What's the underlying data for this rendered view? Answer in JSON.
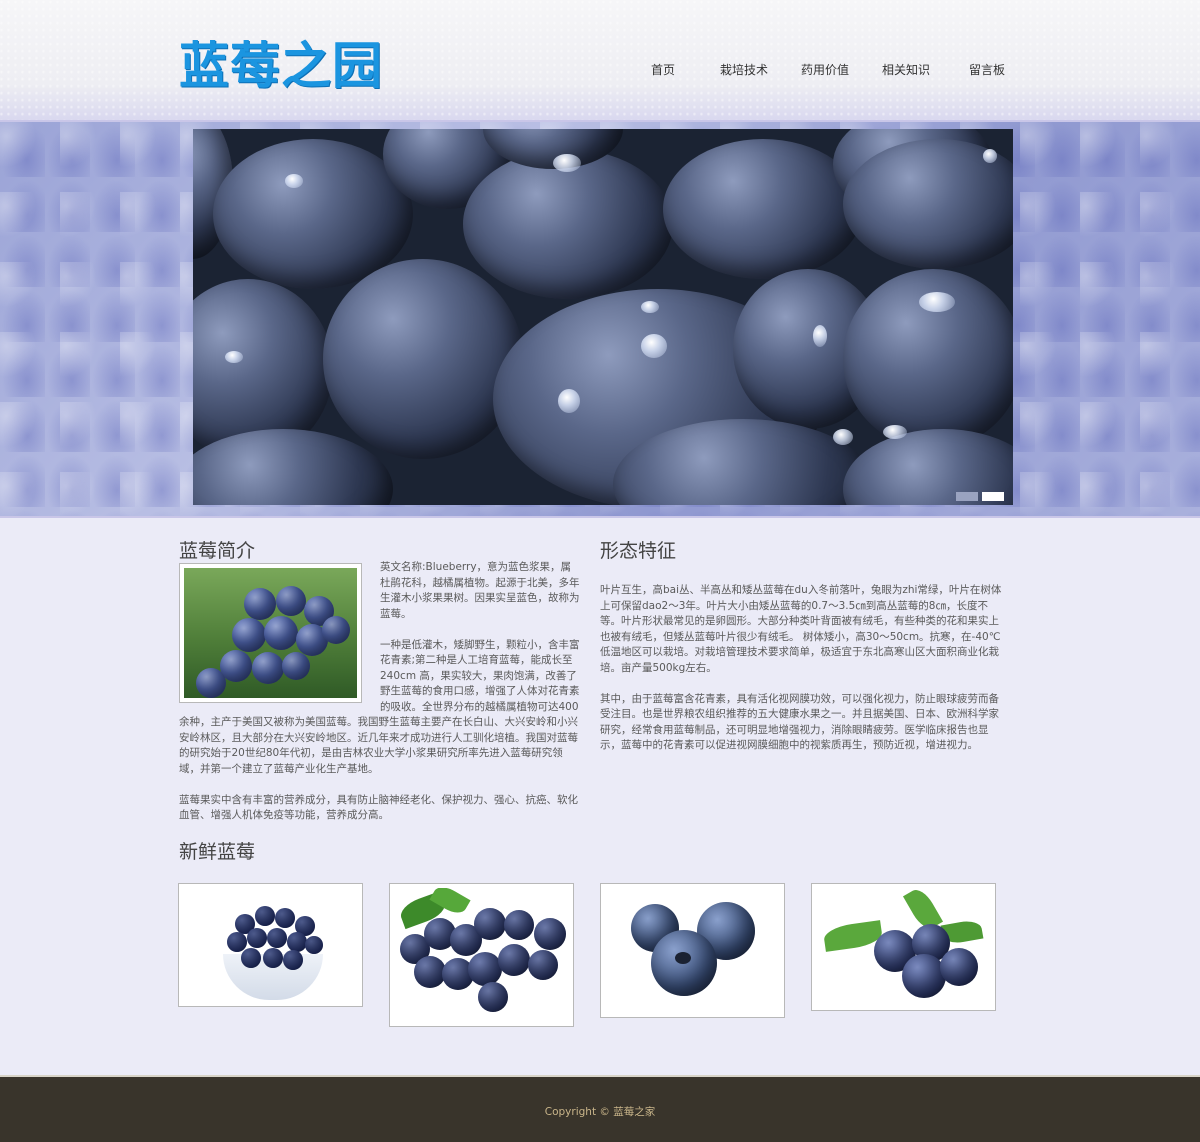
{
  "site": {
    "logo_text": "蓝莓之园"
  },
  "nav": {
    "items": [
      {
        "label": "首页"
      },
      {
        "label": "栽培技术"
      },
      {
        "label": "药用价值"
      },
      {
        "label": "相关知识"
      },
      {
        "label": "留言板"
      }
    ]
  },
  "banner": {
    "image_subject": "blueberries-with-water-drops",
    "dots": [
      {
        "state": "inactive"
      },
      {
        "state": "active"
      }
    ]
  },
  "intro": {
    "title": "蓝莓简介",
    "paragraphs": [
      "英文名称:Blueberry，意为蓝色浆果，属杜鹃花科，越橘属植物。起源于北美，多年生灌木小浆果果树。因果实呈蓝色，故称为蓝莓。",
      "一种是低灌木，矮脚野生，颗粒小，含丰富花青素;第二种是人工培育蓝莓，能成长至240cm 高，果实较大，果肉饱满，改善了野生蓝莓的食用口感，增强了人体对花青素的吸收。全世界分布的越橘属植物可达400余种，主产于美国又被称为美国蓝莓。我国野生蓝莓主要产在长白山、大兴安岭和小兴安岭林区，且大部分在大兴安岭地区。近几年来才成功进行人工驯化培植。我国对蓝莓的研究始于20世纪80年代初，是由吉林农业大学小浆果研究所率先进入蓝莓研究领域，并第一个建立了蓝莓产业化生产基地。",
      "蓝莓果实中含有丰富的营养成分，具有防止脑神经老化、保护视力、强心、抗癌、软化血管、增强人机体免疫等功能，营养成分高。"
    ]
  },
  "features": {
    "title": "形态特征",
    "paragraphs": [
      "叶片互生，高bai丛、半高丛和矮丛蓝莓在du入冬前落叶，兔眼为zhi常绿，叶片在树体上可保留dao2～3年。叶片大小由矮丛蓝莓的0.7～3.5㎝到高丛蓝莓的8㎝，长度不等。叶片形状最常见的是卵圆形。大部分种类叶背面被有绒毛，有些种类的花和果实上也被有绒毛，但矮丛蓝莓叶片很少有绒毛。 树体矮小，高30～50cm。抗寒，在-40℃低温地区可以栽培。对栽培管理技术要求简单，极适宜于东北高寒山区大面积商业化栽培。亩产量500kg左右。",
      "其中，由于蓝莓富含花青素，具有活化视网膜功效，可以强化视力，防止眼球疲劳而备受注目。也是世界粮农组织推荐的五大健康水果之一。并且据美国、日本、欧洲科学家研究，经常食用蓝莓制品，还可明显地增强视力，消除眼睛疲劳。医学临床报告也显示，蓝莓中的花青素可以促进视网膜细胞中的视紫质再生，预防近视，增进视力。"
    ]
  },
  "gallery": {
    "title": "新鲜蓝莓",
    "items": [
      {
        "subject": "blueberries-in-bowl"
      },
      {
        "subject": "blueberries-with-leaves"
      },
      {
        "subject": "three-blueberries"
      },
      {
        "subject": "blueberries-with-leaf"
      }
    ]
  },
  "footer": {
    "copyright": "Copyright © 蓝莓之家"
  },
  "colors": {
    "logo": "#1b95e0",
    "footer_bg": "#39342b",
    "footer_text": "#c9b58a",
    "page_bg": "#ebebf7"
  }
}
